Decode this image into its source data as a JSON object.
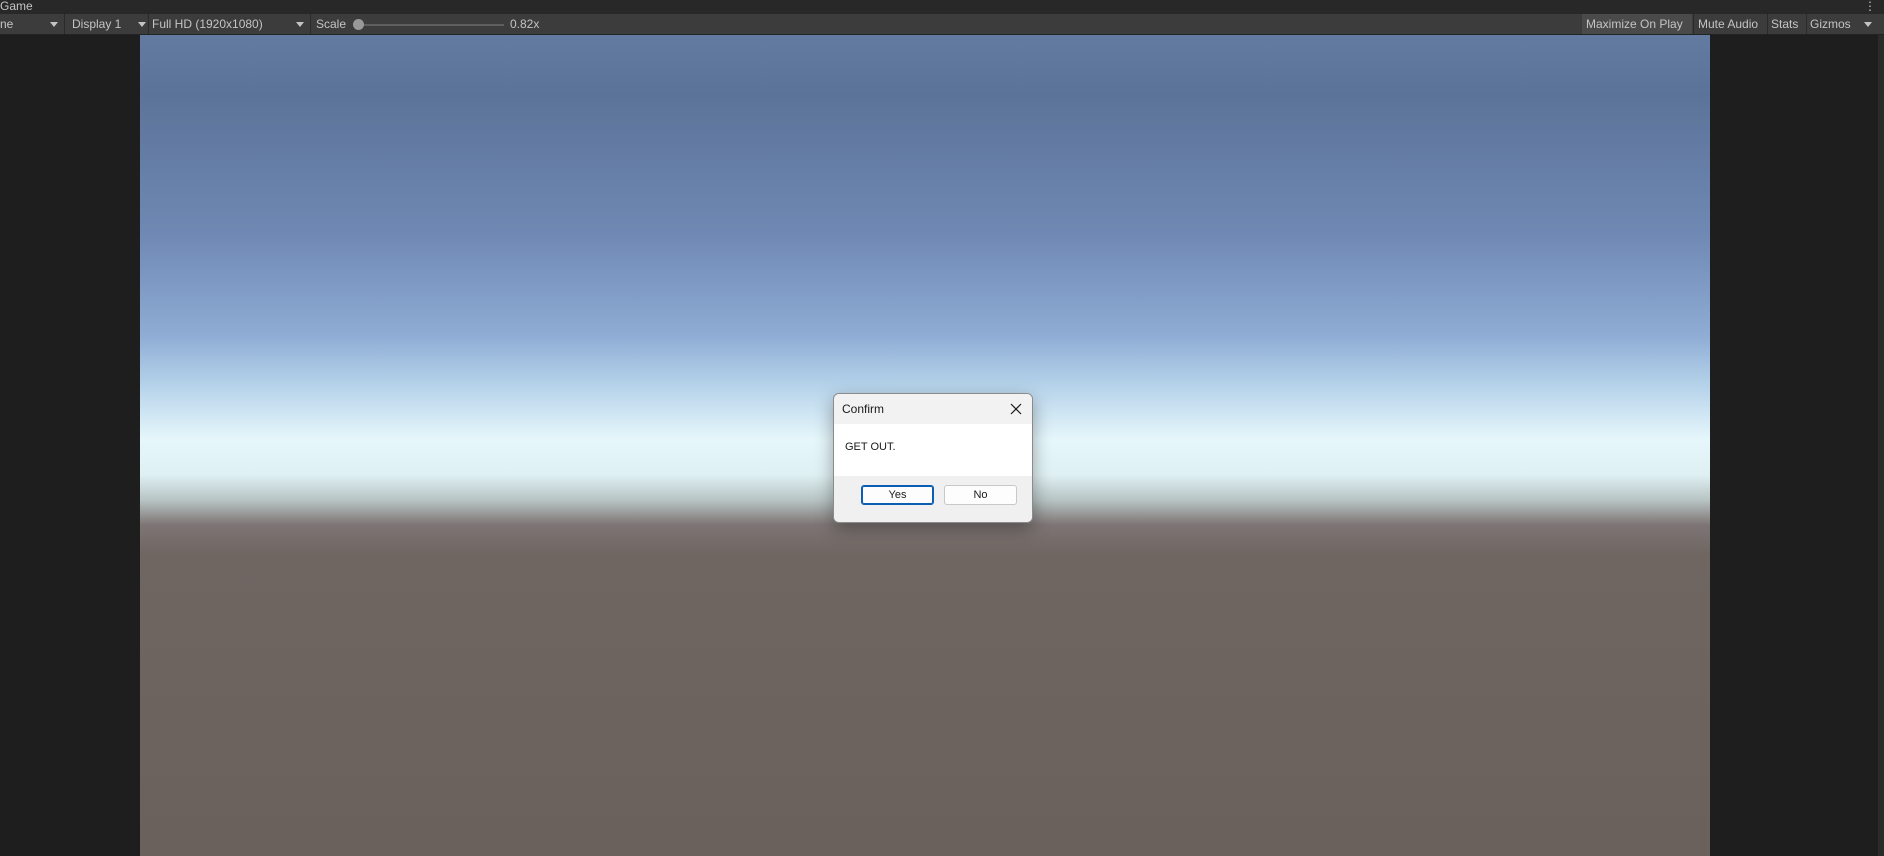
{
  "window": {
    "tab_label": "Game",
    "menu_icon": "kebab-menu-icon"
  },
  "toolbar": {
    "view_dropdown": "ne",
    "display_dropdown": "Display 1",
    "resolution_dropdown": "Full HD (1920x1080)",
    "scale_label": "Scale",
    "scale_value": "0.82x",
    "maximize_on_play": "Maximize On Play",
    "mute_audio": "Mute Audio",
    "stats": "Stats",
    "gizmos": "Gizmos"
  },
  "dialog": {
    "title": "Confirm",
    "message": "GET OUT.",
    "yes_label": "Yes",
    "no_label": "No",
    "close_icon": "close-icon"
  },
  "colors": {
    "editor_dark": "#1e1e1e",
    "toolbar": "#3c3c3c",
    "sky_top": "#5c7399",
    "horizon": "#e6f7fb",
    "ground": "#6a605c",
    "dialog_accent": "#0a5fb4"
  }
}
